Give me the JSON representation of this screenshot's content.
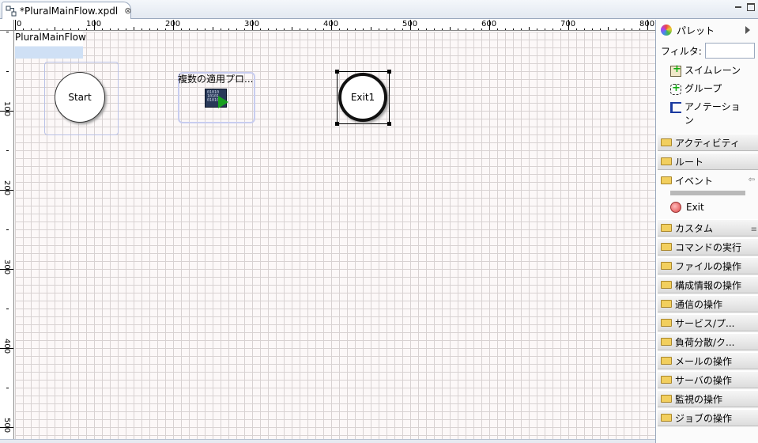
{
  "tab": {
    "title": "*PluralMainFlow.xpdl",
    "close": "⊗"
  },
  "ruler": {
    "top_labels": [
      "0",
      "100",
      "200",
      "300",
      "400",
      "500",
      "600",
      "700",
      "800"
    ],
    "left_labels": [
      "100",
      "200",
      "300",
      "400",
      "500"
    ]
  },
  "canvas": {
    "pool_label": "PluralMainFlow",
    "start_label": "Start",
    "task_label": "複数の適用プロ...",
    "exit_label": "Exit1"
  },
  "palette": {
    "title": "パレット",
    "filter_label": "フィルタ:",
    "filter_value": "",
    "tools": [
      {
        "label": "スイムレーン",
        "icon": "swimlane-icon"
      },
      {
        "label": "グループ",
        "icon": "group-icon"
      },
      {
        "label": "アノテーション",
        "icon": "annotation-icon"
      }
    ],
    "drawers_before": [
      "アクティビティ",
      "ルート"
    ],
    "event_drawer": "イベント",
    "event_tool": "Exit",
    "drawers_after": [
      "カスタム",
      "コマンドの実行",
      "ファイルの操作",
      "構成情報の操作",
      "通信の操作",
      "サービス/プ...",
      "負荷分散/ク...",
      "メールの操作",
      "サーバの操作",
      "監視の操作",
      "ジョブの操作"
    ]
  }
}
